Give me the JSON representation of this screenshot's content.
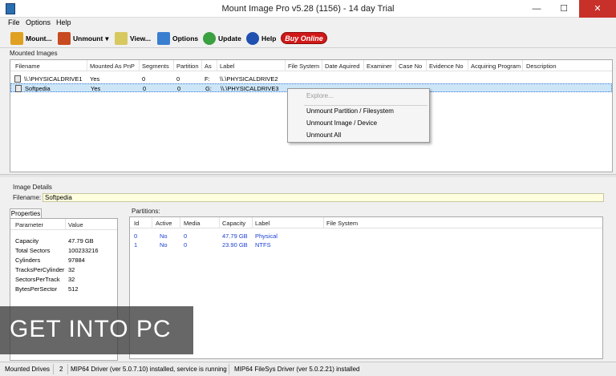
{
  "window": {
    "title": "Mount Image Pro v5.28 (1156) - 14 day Trial",
    "min": "—",
    "max": "☐",
    "close": "✕"
  },
  "menu": [
    "File",
    "Options",
    "Help"
  ],
  "toolbar": {
    "mount": "Mount...",
    "unmount": "Unmount",
    "unmount_arrow": "▾",
    "view": "View...",
    "options": "Options",
    "update": "Update",
    "help": "Help",
    "buy": "Buy Online"
  },
  "mounted": {
    "label": "Mounted Images",
    "columns": [
      "Filename",
      "Mounted As PnP",
      "Segments",
      "Partition",
      "As",
      "Label",
      "File System",
      "Date Aquired",
      "Examiner",
      "Case No",
      "Evidence No",
      "Acquiring Program",
      "Description"
    ],
    "rows": [
      {
        "filename": "\\\\.\\PHYSICALDRIVE1",
        "pnp": "Yes",
        "segments": "0",
        "partition": "0",
        "as": "F:",
        "label": "\\\\.\\PHYSICALDRIVE2"
      },
      {
        "filename": "Softpedia",
        "pnp": "Yes",
        "segments": "0",
        "partition": "0",
        "as": "G:",
        "label": "\\\\.\\PHYSICALDRIVE3"
      }
    ]
  },
  "context_menu": {
    "explore": "Explore...",
    "unmount_partition": "Unmount Partition  / Filesystem",
    "unmount_image": "Unmount Image / Device",
    "unmount_all": "Unmount All"
  },
  "details": {
    "label": "Image Details",
    "filename_label": "Filename:",
    "filename_value": "Softpedia"
  },
  "properties": {
    "tab": "Properties",
    "columns": [
      "Parameter",
      "Value"
    ],
    "rows": [
      {
        "param": "Capacity",
        "value": "47.79 GB"
      },
      {
        "param": "Total Sectors",
        "value": "100233216"
      },
      {
        "param": "Cylinders",
        "value": "97884"
      },
      {
        "param": "TracksPerCylinder",
        "value": "32"
      },
      {
        "param": "SectorsPerTrack",
        "value": "32"
      },
      {
        "param": "BytesPerSector",
        "value": "512"
      }
    ]
  },
  "partitions": {
    "label": "Partitions:",
    "columns": [
      "Id",
      "Active",
      "Media",
      "Capacity",
      "Label",
      "File System"
    ],
    "rows": [
      {
        "id": "0",
        "active": "No",
        "media": "0",
        "capacity": "47.79 GB",
        "label": "Physical",
        "fs": ""
      },
      {
        "id": "1",
        "active": "No",
        "media": "0",
        "capacity": "23.90 GB",
        "label": "NTFS",
        "fs": ""
      }
    ]
  },
  "status": {
    "mounted": "Mounted Drives",
    "count": "2",
    "driver1": "MIP64 Driver (ver 5.0.7.10) installed, service is running",
    "driver2": "MIP64 FileSys Driver (ver 5.0.2.21) installed"
  },
  "watermark": "GET INTO PC"
}
